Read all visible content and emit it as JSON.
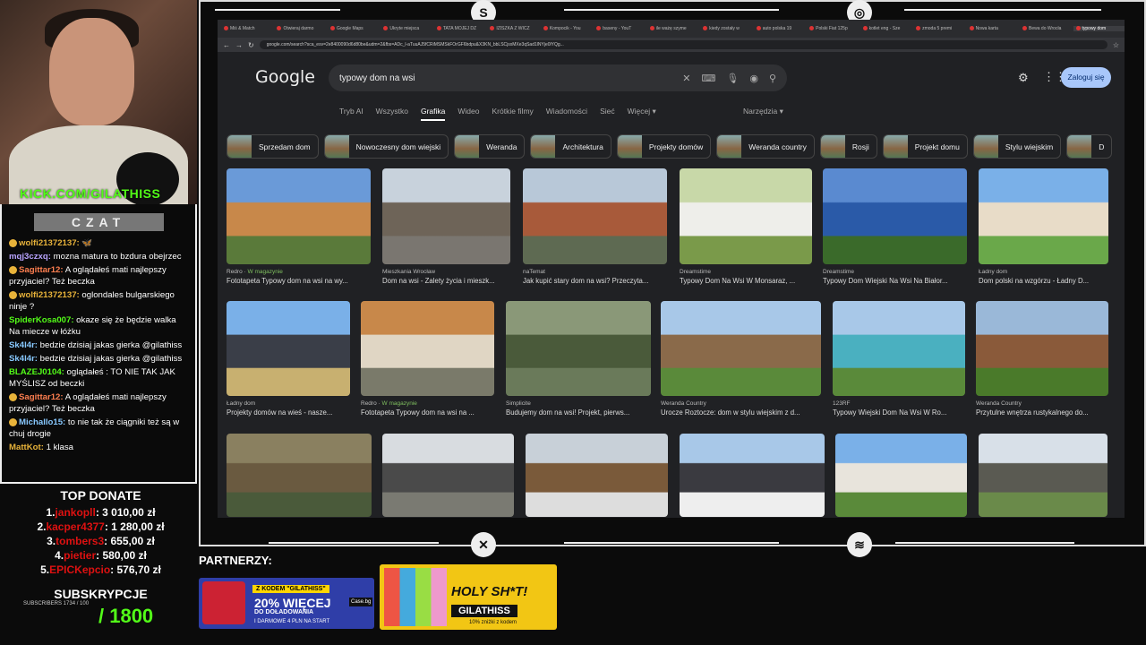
{
  "stream": {
    "kick": "KICK.COM/GILATHISS",
    "chat_title": "CZAT",
    "chat": [
      {
        "user": "wolfi21372137:",
        "text": " 🦋",
        "color": "#e8b33a",
        "badge": true
      },
      {
        "user": "mqj3czxq:",
        "text": " mozna matura to bzdura obejrzec",
        "color": "#b9a4ff",
        "badge": false
      },
      {
        "user": "Sagittar12:",
        "text": " A oglądałeś mati najlepszy przyjaciel? Też beczka",
        "color": "#ff7f50",
        "badge": true
      },
      {
        "user": "wolfi21372137:",
        "text": " oglondales bulgarskiego ninje ?",
        "color": "#e8b33a",
        "badge": true
      },
      {
        "user": "SpiderKosa007:",
        "text": " okaze się że będzie walka Na miecze w łóżku",
        "color": "#53fc18",
        "badge": false
      },
      {
        "user": "Sk4l4r:",
        "text": " bedzie dzisiaj jakas gierka @gilathiss",
        "color": "#88c9ff",
        "badge": false
      },
      {
        "user": "Sk4l4r:",
        "text": " bedzie dzisiaj jakas gierka @gilathiss",
        "color": "#88c9ff",
        "badge": false
      },
      {
        "user": "BLAZEJ0104:",
        "text": " oglądałeś : TO NIE TAK JAK MYŚLISZ od beczki",
        "color": "#53fc18",
        "badge": false
      },
      {
        "user": "Sagittar12:",
        "text": " A oglądałeś mati najlepszy przyjaciel? Też beczka",
        "color": "#ff7f50",
        "badge": true
      },
      {
        "user": "Michallo15:",
        "text": " to nie tak że ciągniki też są w chuj drogie",
        "color": "#88c9ff",
        "badge": true
      },
      {
        "user": "MattKot:",
        "text": " 1 klasa",
        "color": "#e8b33a",
        "badge": false
      }
    ],
    "top_donate_title": "TOP DONATE",
    "donates": [
      {
        "rank": "1.",
        "name": "jankopll",
        "amount": ": 3 010,00 zł"
      },
      {
        "rank": "2.",
        "name": "kacper4377",
        "amount": ": 1 280,00 zł"
      },
      {
        "rank": "3.",
        "name": "tombers3",
        "amount": ": 655,00 zł"
      },
      {
        "rank": "4.",
        "name": "pietier",
        "amount": ": 580,00 zł"
      },
      {
        "rank": "5.",
        "name": "EPICKepcio",
        "amount": ": 576,70 zł"
      }
    ],
    "subs_title": "SUBSKRYPCJE",
    "subs_small": "SUBSCRIBERS 1734 / 100",
    "subs_goal": "/ 1800",
    "partners": "PARTNERZY:",
    "ad1": {
      "code": "Z KODEM \"GILATHISS\"",
      "promo": "20% WIĘCEJ",
      "sub": "DO DOŁADOWANIA",
      "small": "I DARMOWE 4 PLN NA START",
      "logo": "Case.bg"
    },
    "ad2": {
      "title": "HOLY SH*T!",
      "code": "GILATHISS",
      "small": "10% zniżki z kodem"
    }
  },
  "browser": {
    "tabs": [
      "Miś & Match",
      "Otwieraj darmo",
      "Google Maps",
      "Ukryte miejsca",
      "TATA MOJEJ DZ",
      "IZISZKA Z WICZ",
      "Kompocik - You",
      "baseny - YouT",
      "ile ważę szyme",
      "kiedy zostały w",
      "auto polska 19",
      "Polski Fiat 125p",
      "kotlet eng - Sze",
      "zmoda 5 premi",
      "Nowa karta",
      "Bewa do Wrocła",
      "typowy dom"
    ],
    "url": "google.com/search?sca_esv=2e8400090d6d80be&udm=2&fbs=ADc_l-aTuuAJ5fCRiMSMSkFOrGF6bdpu&X3KN_bbLSCjsxMXe3qSad1lNYje0lYQg..."
  },
  "google": {
    "logo": "Google",
    "query": "typowy dom na wsi",
    "login": "Zaloguj się",
    "tabs": [
      "Tryb AI",
      "Wszystko",
      "Grafika",
      "Wideo",
      "Krótkie filmy",
      "Wiadomości",
      "Sieć",
      "Więcej ▾"
    ],
    "tools": "Narzędzia ▾",
    "chips": [
      "Sprzedam dom",
      "Nowoczesny dom wiejski",
      "Weranda",
      "Architektura",
      "Projekty domów",
      "Weranda country",
      "Rosji",
      "Projekt domu",
      "Stylu wiejskim",
      "D"
    ],
    "results": [
      [
        {
          "src": "Redro",
          "mag": "W magazynie",
          "cap": "Fototapeta Typowy dom na wsi na wy...",
          "colors": [
            "#6a9ad8",
            "#c8884a",
            "#5a7a3a"
          ]
        },
        {
          "src": "Mieszkania Wrocław",
          "mag": "",
          "cap": "Dom na wsi - Zalety życia i mieszk...",
          "colors": [
            "#c8d2dc",
            "#6e6458",
            "#7a7670"
          ]
        },
        {
          "src": "naTemat",
          "mag": "",
          "cap": "Jak kupić stary dom na wsi? Przeczyta...",
          "colors": [
            "#b8c8d8",
            "#a85a3a",
            "#5e6a52"
          ]
        },
        {
          "src": "Dreamstime",
          "mag": "",
          "cap": "Typowy Dom Na Wsi W Monsaraz, ...",
          "colors": [
            "#c8d8a8",
            "#eeeeea",
            "#7a9a4a"
          ]
        },
        {
          "src": "Dreamstime",
          "mag": "",
          "cap": "Typowy Dom Wiejski Na Wsi Na Białor...",
          "colors": [
            "#5a8ad0",
            "#2a5aa8",
            "#3a6a2a"
          ]
        },
        {
          "src": "Ładny dom",
          "mag": "",
          "cap": "Dom polski na wzgórzu - Ładny D...",
          "colors": [
            "#7ab0e8",
            "#e8dcc8",
            "#6aa84a"
          ]
        }
      ],
      [
        {
          "src": "Ładny dom",
          "mag": "",
          "cap": "Projekty domów na wieś - nasze...",
          "colors": [
            "#7ab0e8",
            "#3a3e48",
            "#c8b070"
          ]
        },
        {
          "src": "Redro",
          "mag": "W magazynie",
          "cap": "Fototapeta Typowy dom na wsi na ...",
          "colors": [
            "#c8884a",
            "#e0d6c4",
            "#7a7a6a"
          ]
        },
        {
          "src": "Simplicite",
          "mag": "",
          "cap": "Budujemy dom na wsi! Projekt, pierws...",
          "colors": [
            "#8a9878",
            "#4a5a3a",
            "#6a7a5a"
          ]
        },
        {
          "src": "Weranda Country",
          "mag": "",
          "cap": "Urocze Roztocze: dom w stylu wiejskim z d...",
          "colors": [
            "#a8c8e8",
            "#8a6a4a",
            "#5a8a3a"
          ]
        },
        {
          "src": "123RF",
          "mag": "",
          "cap": "Typowy Wiejski Dom Na Wsi W Ro...",
          "colors": [
            "#a8c8e8",
            "#4ab0c0",
            "#5a8a3a"
          ]
        },
        {
          "src": "Weranda Country",
          "mag": "",
          "cap": "Przytulne wnętrza rustykalnego do...",
          "colors": [
            "#9ab8d8",
            "#8a5a3a",
            "#4a7a2a"
          ]
        }
      ],
      [
        {
          "src": "",
          "mag": "",
          "cap": "",
          "colors": [
            "#8a8060",
            "#6a5a40",
            "#4a5a3a"
          ]
        },
        {
          "src": "",
          "mag": "",
          "cap": "",
          "colors": [
            "#d8dce0",
            "#4a4a4a",
            "#7a7a72"
          ]
        },
        {
          "src": "",
          "mag": "",
          "cap": "",
          "colors": [
            "#c8d0d8",
            "#7a5a3a",
            "#ddd"
          ]
        },
        {
          "src": "",
          "mag": "",
          "cap": "",
          "colors": [
            "#a8c8e8",
            "#3a3a40",
            "#eee"
          ]
        },
        {
          "src": "",
          "mag": "",
          "cap": "",
          "colors": [
            "#7ab0e8",
            "#e8e4dc",
            "#5a8a3a"
          ]
        },
        {
          "src": "",
          "mag": "",
          "cap": "",
          "colors": [
            "#d8e0e8",
            "#5a5a52",
            "#6a8a4a"
          ]
        }
      ]
    ]
  }
}
